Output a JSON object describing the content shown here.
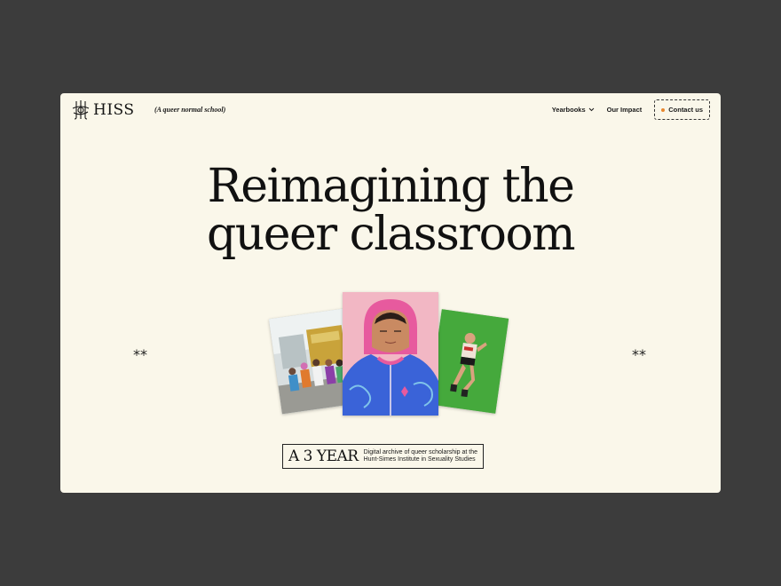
{
  "header": {
    "logo_text": "HISS",
    "tagline": "(A queer normal school)",
    "nav": [
      {
        "label": "Yearbooks",
        "has_dropdown": true
      },
      {
        "label": "Our Impact",
        "has_dropdown": false
      }
    ],
    "contact_label": "Contact us"
  },
  "hero": {
    "line1": "Reimagining the",
    "line2": "queer classroom",
    "left_mark": "**",
    "right_mark": "**"
  },
  "badge": {
    "big": "A 3 YEAR",
    "small_line1": "Digital archive of queer scholarship at the",
    "small_line2": "Hunt-Simes Institute in Sexuality Studies"
  },
  "colors": {
    "background": "#3c3c3c",
    "card": "#faf7ea",
    "accent_dot": "#e8872e",
    "text": "#111111"
  }
}
